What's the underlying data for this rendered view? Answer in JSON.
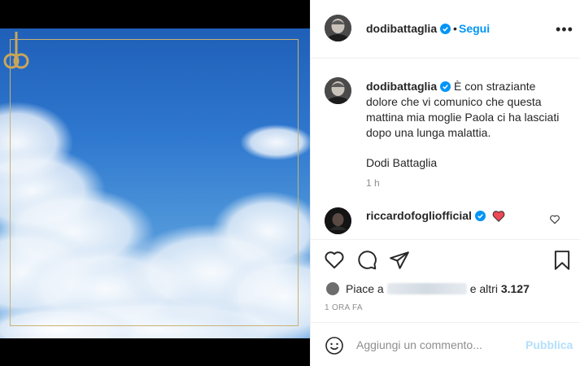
{
  "post": {
    "username": "dodibattaglia",
    "verified": true,
    "separator": "•",
    "follow_label": "Segui",
    "more_label": "•••"
  },
  "caption": {
    "username": "dodibattaglia",
    "text": "È con straziante dolore che vi comunico che questa mattina mia moglie Paola ci ha lasciati dopo una lunga malattia.",
    "signature": "Dodi Battaglia",
    "time": "1 h"
  },
  "comments": [
    {
      "username": "riccardofogliofficial",
      "verified": true,
      "content": "heart-emoji"
    }
  ],
  "likes": {
    "prefix": "Piace a",
    "suffix_text": "e altri",
    "count": "3.127"
  },
  "timestamp": "1 ORA FA",
  "comment_input": {
    "placeholder": "Aggiungi un commento...",
    "publish_label": "Pubblica"
  },
  "colors": {
    "accent": "#0095f6",
    "publish_disabled": "#b2dffc",
    "frame_gold": "#c9b174",
    "heart_red": "#ed4956"
  },
  "icons": [
    "verified-badge-icon",
    "heart-icon",
    "comment-icon",
    "share-icon",
    "bookmark-icon",
    "emoji-icon",
    "more-options-icon"
  ]
}
